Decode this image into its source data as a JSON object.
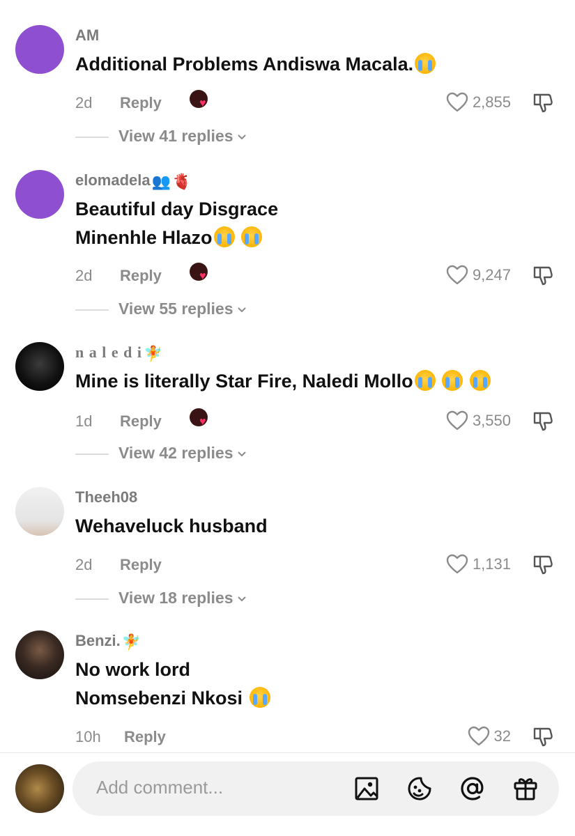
{
  "comments": [
    {
      "username": "AM",
      "text_lines": [
        "Additional Problems Andiswa Macala."
      ],
      "time": "2d",
      "reply_label": "Reply",
      "likes": "2,855",
      "view_replies": "View 41 replies",
      "avatar": "purple"
    },
    {
      "username": "elomadela",
      "text_lines": [
        "Beautiful day Disgrace",
        "Minenhle Hlazo"
      ],
      "time": "2d",
      "reply_label": "Reply",
      "likes": "9,247",
      "view_replies": "View 55 replies",
      "avatar": "purple"
    },
    {
      "username": "n a l e d i",
      "text_lines": [
        "Mine is literally Star Fire, Naledi Mollo"
      ],
      "time": "1d",
      "reply_label": "Reply",
      "likes": "3,550",
      "view_replies": "View 42 replies",
      "avatar": "dark"
    },
    {
      "username": "Theeh08",
      "text_lines": [
        "Wehaveluck husband"
      ],
      "time": "2d",
      "reply_label": "Reply",
      "likes": "1,131",
      "view_replies": "View 18 replies",
      "avatar": "light"
    },
    {
      "username": "Benzi.",
      "text_lines": [
        "No work lord",
        "Nomsebenzi Nkosi"
      ],
      "time": "10h",
      "reply_label": "Reply",
      "likes": "32",
      "avatar": "photo"
    }
  ],
  "input": {
    "placeholder": "Add comment..."
  },
  "icons": {
    "like": "heart-outline-icon",
    "dislike": "thumbs-down-icon",
    "creator_liked": "creator-heart-badge-icon",
    "chevron": "chevron-down-icon",
    "toolbar": [
      "image-icon",
      "emoji-icon",
      "mention-icon",
      "gift-icon"
    ]
  },
  "colors": {
    "muted_text": "#8b8b8b",
    "creator_heart": "#ff2e63",
    "input_bg": "#f1f1f1"
  }
}
